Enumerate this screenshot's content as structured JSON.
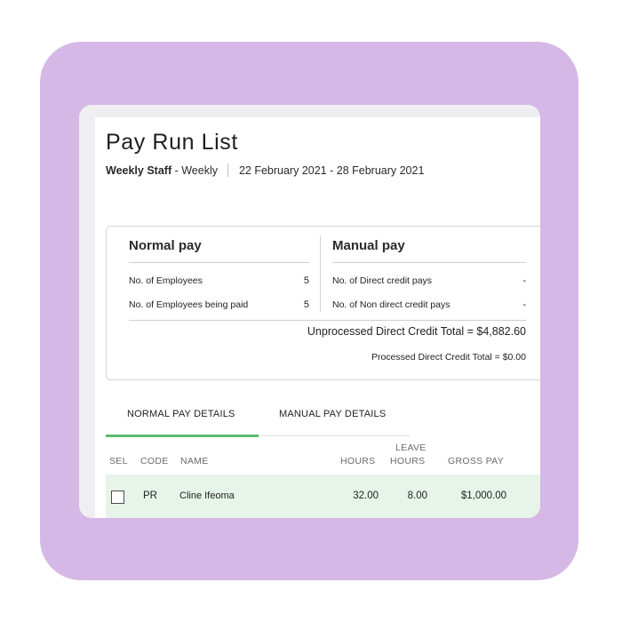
{
  "page": {
    "title": "Pay Run List",
    "staff_group": "Weekly Staff",
    "frequency": "- Weekly",
    "period": "22 February 2021 - 28 February 2021"
  },
  "normal_pay": {
    "title": "Normal pay",
    "rows": [
      {
        "label": "No. of Employees",
        "value": "5"
      },
      {
        "label": "No. of Employees being paid",
        "value": "5"
      }
    ]
  },
  "manual_pay": {
    "title": "Manual pay",
    "rows": [
      {
        "label": "No. of Direct credit pays",
        "value": "-"
      },
      {
        "label": "No. of Non direct credit pays",
        "value": "-"
      }
    ]
  },
  "totals": {
    "unprocessed": "Unprocessed Direct Credit Total  =  $4,882.60",
    "processed": "Processed Direct Credit Total  =  $0.00"
  },
  "tabs": [
    {
      "label": "NORMAL PAY DETAILS",
      "active": true
    },
    {
      "label": "MANUAL PAY DETAILS",
      "active": false
    }
  ],
  "table": {
    "headers": {
      "sel": "SEL",
      "code": "CODE",
      "name": "NAME",
      "hours": "HOURS",
      "leave_1": "LEAVE",
      "leave_2": "HOURS",
      "gross": "GROSS PAY"
    },
    "rows": [
      {
        "selected": false,
        "code": "PR",
        "name": "Cline Ifeoma",
        "hours": "32.00",
        "leave_hours": "8.00",
        "gross_pay": "$1,000.00"
      }
    ]
  },
  "colors": {
    "frame": "#d5b8e6",
    "accent_green": "#5dbb6b",
    "row_highlight": "#e7f4e9"
  }
}
